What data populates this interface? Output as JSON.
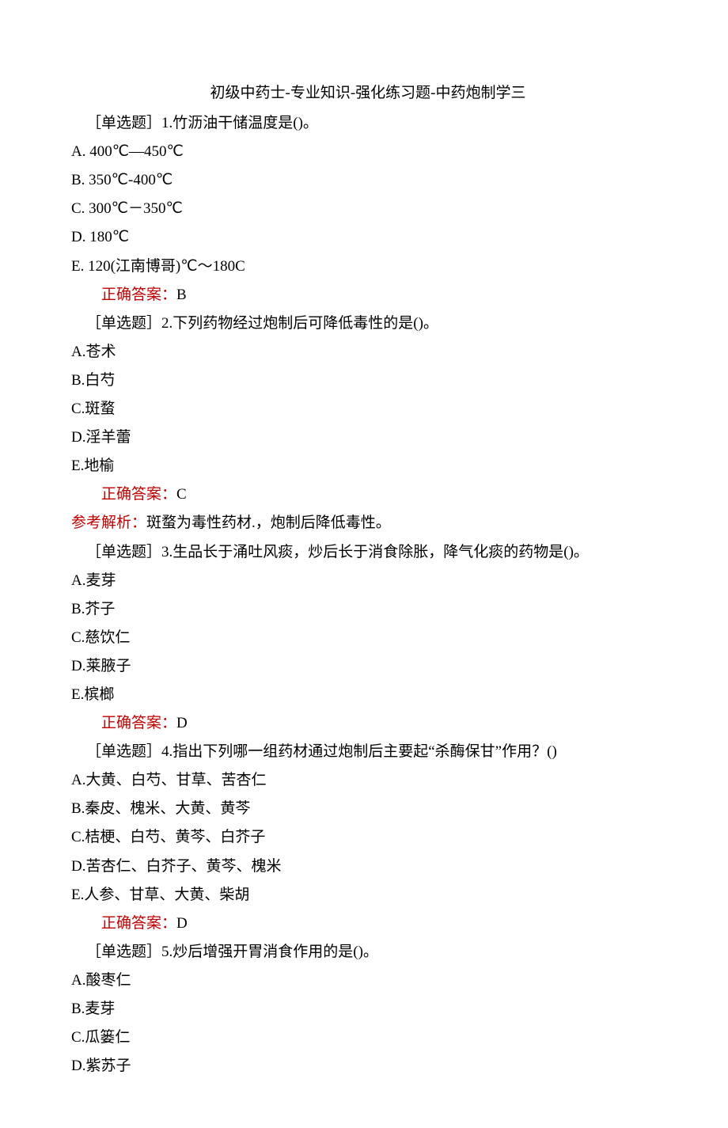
{
  "title": "初级中药士-专业知识-强化练习题-中药炮制学三",
  "questions": [
    {
      "stem": "［单选题］1.竹沥油干储温度是()。",
      "options": [
        "A. 400℃—450℃",
        "B. 350℃-400℃",
        "C. 300℃－350℃",
        "D. 180℃",
        "E. 120(江南博哥)℃～180C"
      ],
      "answer_label": "正确答案：",
      "answer_value": "B",
      "explain_label": "",
      "explain_text": ""
    },
    {
      "stem": "［单选题］2.下列药物经过炮制后可降低毒性的是()。",
      "options": [
        "A.苍术",
        "B.白芍",
        "C.斑蝥",
        "D.淫羊蕾",
        "E.地榆"
      ],
      "answer_label": "正确答案：",
      "answer_value": "C",
      "explain_label": "参考解析：",
      "explain_text": "斑蝥为毒性药材.，炮制后降低毒性。"
    },
    {
      "stem": "［单选题］3.生品长于涌吐风痰，炒后长于消食除胀，降气化痰的药物是()。",
      "options": [
        "A.麦芽",
        "B.芥子",
        "C.慈饮仁",
        "D.莱腋子",
        "E.槟榔"
      ],
      "answer_label": "正确答案：",
      "answer_value": "D",
      "explain_label": "",
      "explain_text": ""
    },
    {
      "stem": "［单选题］4.指出下列哪一组药材通过炮制后主要起“杀酶保甘”作用？()",
      "options": [
        "A.大黄、白芍、甘草、苦杏仁",
        "B.秦皮、槐米、大黄、黄芩",
        "C.桔梗、白芍、黄芩、白芥子",
        "D.苦杏仁、白芥子、黄芩、槐米",
        "E.人参、甘草、大黄、柴胡"
      ],
      "answer_label": "正确答案：",
      "answer_value": "D",
      "explain_label": "",
      "explain_text": ""
    },
    {
      "stem": "［单选题］5.炒后增强开胃消食作用的是()。",
      "options": [
        "A.酸枣仁",
        "B.麦芽",
        "C.瓜篓仁",
        "D.紫苏子"
      ],
      "answer_label": "",
      "answer_value": "",
      "explain_label": "",
      "explain_text": ""
    }
  ]
}
